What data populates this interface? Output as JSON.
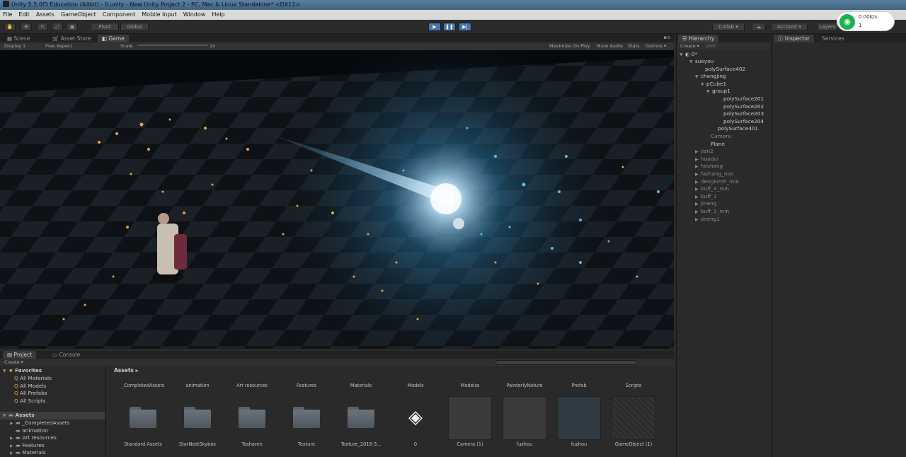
{
  "title": "Unity 5.5.0f3 Education (64bit) - 0.unity - New Unity Project 2 - PC, Mac & Linux Standalone* <DX11>",
  "menu": [
    "File",
    "Edit",
    "Assets",
    "GameObject",
    "Component",
    "Mobile Input",
    "Window",
    "Help"
  ],
  "toolbar": {
    "pivot": "Pivot",
    "global": "Global",
    "collab": "Collab ▾",
    "account": "Account ▾",
    "layers": "Layers"
  },
  "network": {
    "speed": "0.00K/s",
    "count": "1"
  },
  "game_tabs": [
    "Scene",
    "Asset Store",
    "Game"
  ],
  "game_toolbar": {
    "display": "Display 1",
    "aspect": "Free Aspect",
    "scale_label": "Scale",
    "scale_value": "1x",
    "maximize": "Maximize On Play",
    "mute": "Mute Audio",
    "stats": "Stats",
    "gizmos": "Gizmos ▾"
  },
  "hierarchy": {
    "tab": "Hierarchy",
    "create": "Create ▾",
    "search": "Q▾All",
    "scene": "0*",
    "items": [
      {
        "label": "suoyou",
        "arrow": "▼"
      },
      {
        "label": "polySurface402",
        "arrow": ""
      },
      {
        "label": "changjing",
        "arrow": "▼"
      },
      {
        "label": "pCube1",
        "arrow": "▼"
      },
      {
        "label": "group1",
        "arrow": "▼"
      },
      {
        "label": "polySurface201",
        "arrow": ""
      },
      {
        "label": "polySurface202",
        "arrow": ""
      },
      {
        "label": "polySurface203",
        "arrow": ""
      },
      {
        "label": "polySurface204",
        "arrow": ""
      },
      {
        "label": "polySurface401",
        "arrow": ""
      },
      {
        "label": "Camera",
        "arrow": ""
      },
      {
        "label": "Plane",
        "arrow": ""
      },
      {
        "label": "jian2",
        "arrow": "▶"
      },
      {
        "label": "huodui",
        "arrow": "▶"
      },
      {
        "label": "heshang",
        "arrow": "▶"
      },
      {
        "label": "fazhang_min",
        "arrow": "▶"
      },
      {
        "label": "denglomh_min",
        "arrow": "▶"
      },
      {
        "label": "buff_4_min",
        "arrow": "▶"
      },
      {
        "label": "buff_1",
        "arrow": "▶"
      },
      {
        "label": "jineng",
        "arrow": "▶"
      },
      {
        "label": "buff_3_min",
        "arrow": "▶"
      },
      {
        "label": "jineng1",
        "arrow": "▶"
      }
    ]
  },
  "inspector": {
    "tab": "Inspector",
    "services": "Services"
  },
  "project": {
    "tabs": [
      "Project",
      "Console"
    ],
    "create": "Create ▾",
    "breadcrumb": "Assets ▸",
    "favorites_title": "Favorites",
    "favorites": [
      "All Materials",
      "All Models",
      "All Prefabs",
      "All Scripts"
    ],
    "assets_title": "Assets",
    "folders": [
      "_CompletedAssets",
      "animation",
      "Art resources",
      "Features",
      "Materials"
    ],
    "top_labels": [
      "_CompletedAssets",
      "animation",
      "Art resources",
      "Features",
      "Materials",
      "Models",
      "Modelss",
      "PainterlyNature",
      "Prefab",
      "Scripts"
    ],
    "bottom_labels": [
      "Standard Assets",
      "StarNestSkybox",
      "Tasharen",
      "Texture",
      "Texture_2016-3...",
      "0",
      "Camera (1)",
      "fuzhou",
      "fuzhou",
      "GameObject (1)"
    ]
  }
}
